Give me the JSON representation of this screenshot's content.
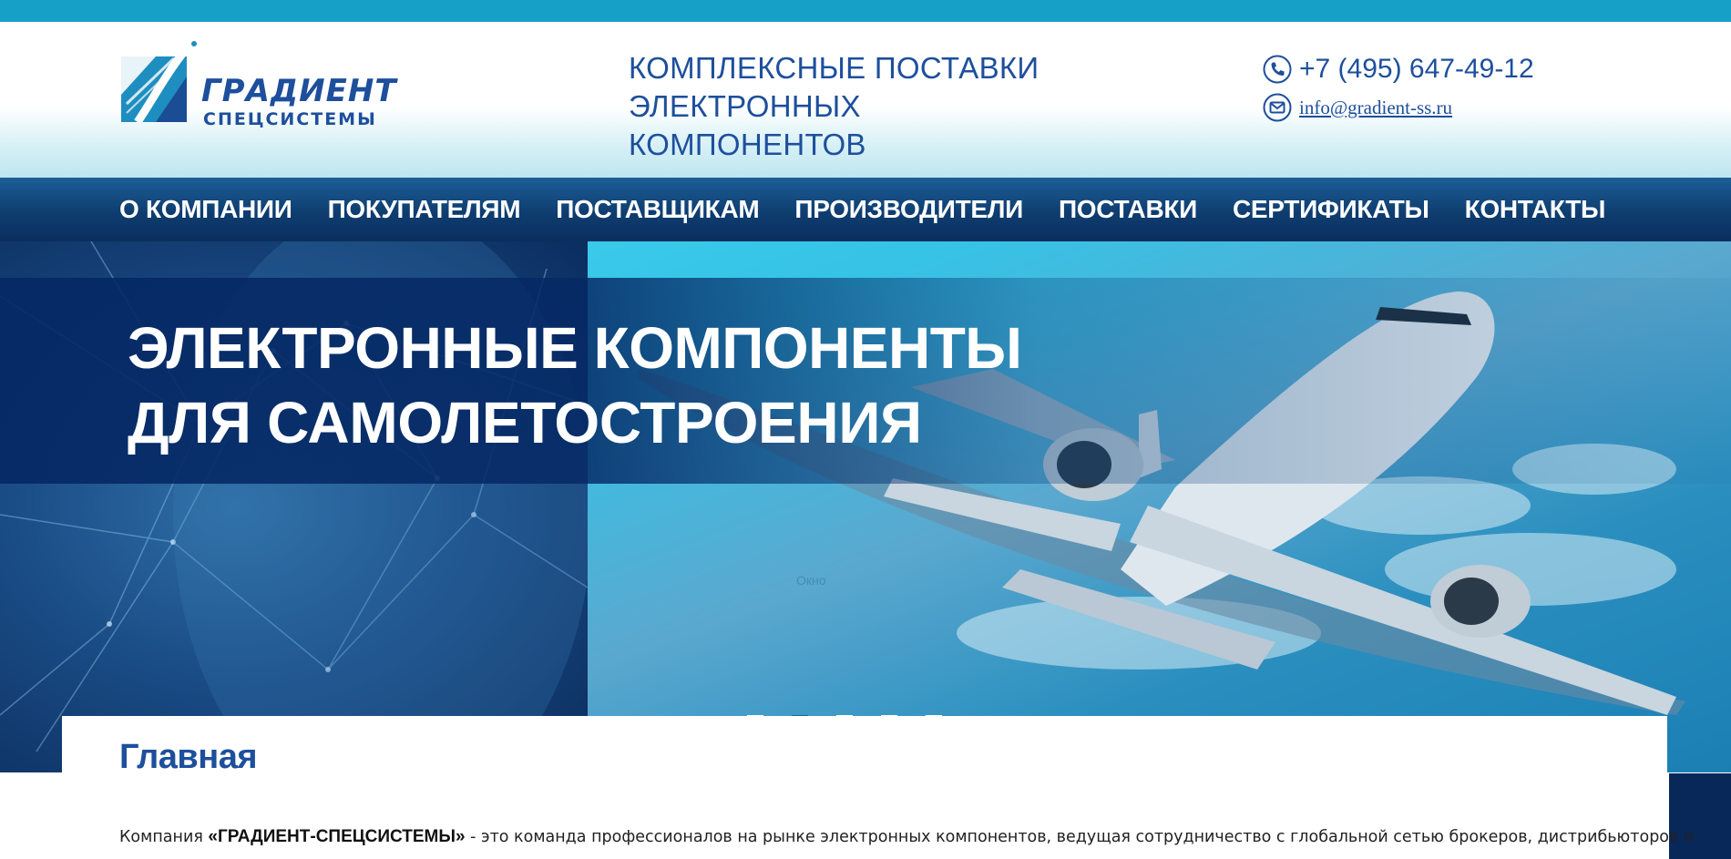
{
  "brand": {
    "name_line1": "ГРАДИЕНТ",
    "name_line2": "СПЕЦСИСТЕМЫ"
  },
  "header": {
    "tagline_line1": "КОМПЛЕКСНЫЕ ПОСТАВКИ",
    "tagline_line2": "ЭЛЕКТРОННЫХ КОМПОНЕНТОВ",
    "phone": "+7 (495) 647-49-12",
    "email": "info@gradient-ss.ru"
  },
  "nav": {
    "items": [
      {
        "label": "О КОМПАНИИ"
      },
      {
        "label": "ПОКУПАТЕЛЯМ"
      },
      {
        "label": "ПОСТАВЩИКАМ"
      },
      {
        "label": "ПРОИЗВОДИТЕЛИ"
      },
      {
        "label": "ПОСТАВКИ"
      },
      {
        "label": "СЕРТИФИКАТЫ"
      },
      {
        "label": "КОНТАКТЫ"
      }
    ]
  },
  "hero": {
    "title_line1": "ЭЛЕКТРОННЫЕ КОМПОНЕНТЫ",
    "title_line2": "ДЛЯ САМОЛЕТОСТРОЕНИЯ",
    "ghost_text": "Окно",
    "slides_count": 5,
    "active_slide": 2
  },
  "main": {
    "page_title": "Главная",
    "intro_prefix": "Компания ",
    "intro_company": "«ГРАДИЕНТ-СПЕЦСИСТЕМЫ»",
    "intro_rest": " - это команда профессионалов на рынке электронных компонентов, ведущая сотрудничество с глобальной сетью брокеров, дистрибьюторов и"
  },
  "colors": {
    "brand_blue": "#1d4f9c",
    "top_strip": "#16a0c8",
    "nav_dark": "#0f3d70",
    "dot_active": "#0d6aa6"
  },
  "icons": {
    "phone": "phone-icon",
    "email": "envelope-icon"
  }
}
